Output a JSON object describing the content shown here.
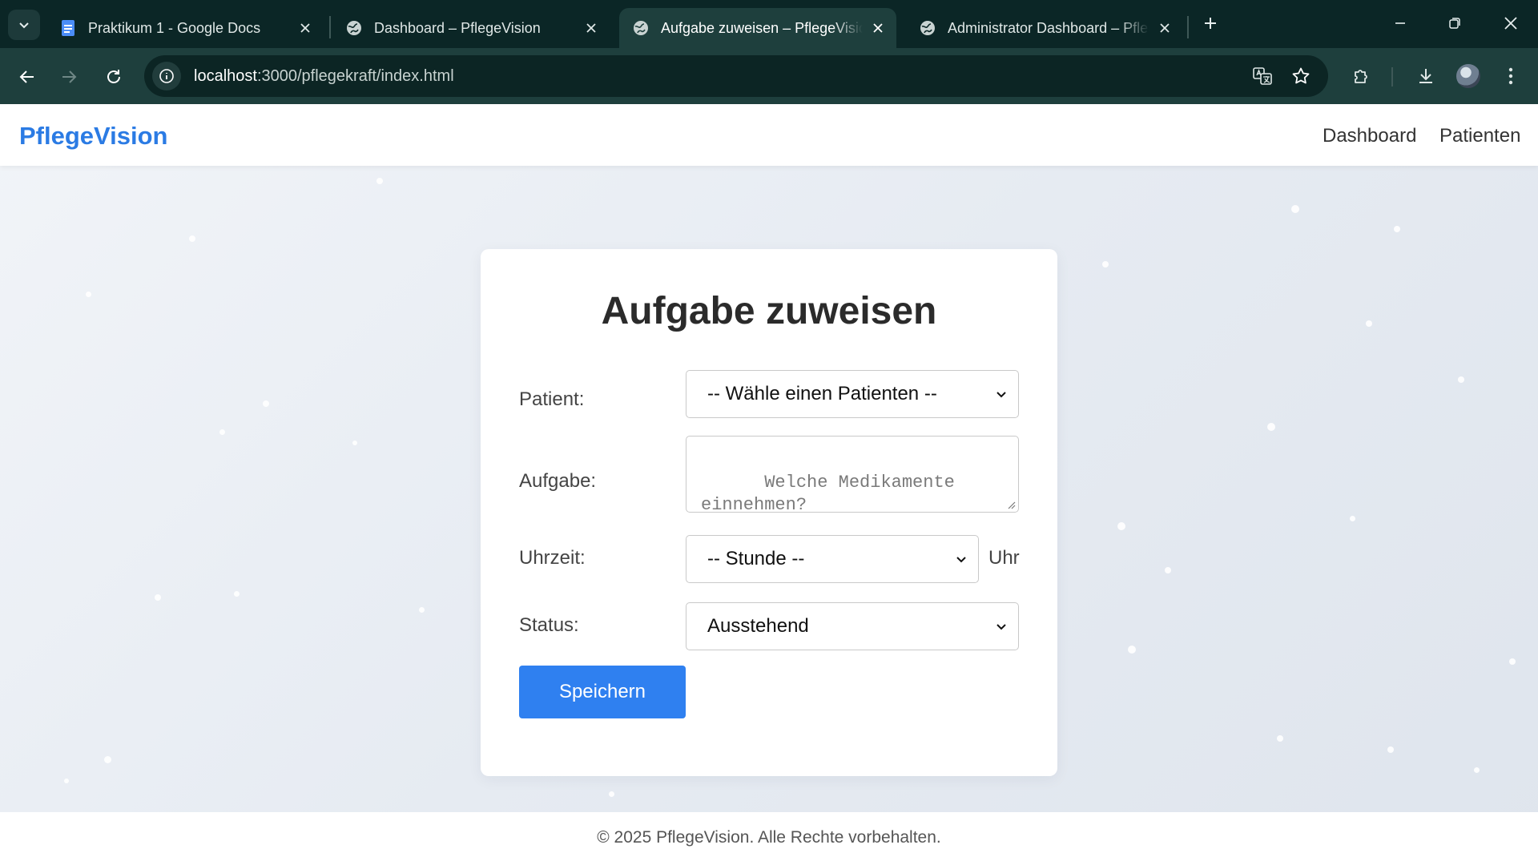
{
  "browser": {
    "tabs": [
      {
        "title": "Praktikum 1 - Google Docs",
        "favicon": "google-docs-icon",
        "active": false
      },
      {
        "title": "Dashboard – PflegeVision",
        "favicon": "globe-icon",
        "active": false
      },
      {
        "title": "Aufgabe zuweisen – PflegeVision",
        "favicon": "globe-icon",
        "active": true
      },
      {
        "title": "Administrator Dashboard – PflegeVision",
        "favicon": "globe-icon",
        "active": false
      }
    ],
    "url_host": "localhost",
    "url_rest": ":3000/pflegekraft/index.html"
  },
  "site": {
    "brand": "PflegeVision",
    "nav": [
      "Dashboard",
      "Patienten"
    ]
  },
  "form": {
    "title": "Aufgabe zuweisen",
    "patient_label": "Patient:",
    "patient_value": "-- Wähle einen Patienten --",
    "task_label": "Aufgabe:",
    "task_placeholder": "Welche Medikamente einnehmen?",
    "time_label": "Uhrzeit:",
    "time_value": "-- Stunde --",
    "time_suffix": "Uhr",
    "status_label": "Status:",
    "status_value": "Ausstehend",
    "save_label": "Speichern"
  },
  "footer": {
    "text": "© 2025 PflegeVision. Alle Rechte vorbehalten."
  },
  "colors": {
    "brand": "#2b7be4",
    "button": "#2f80f0",
    "chrome_dark": "#0b2626",
    "chrome_toolbar": "#1e3f3d"
  }
}
